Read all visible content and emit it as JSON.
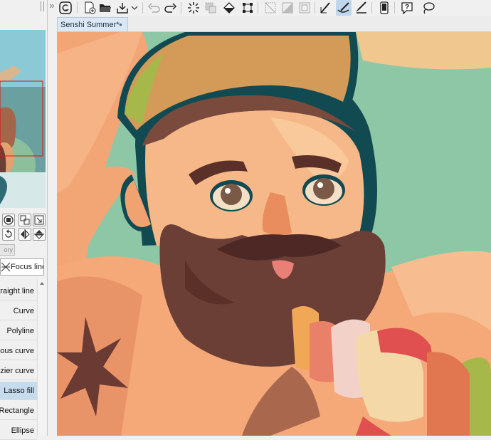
{
  "document": {
    "title": "Senshi Summer*",
    "modified_marker": "●"
  },
  "sub_panel": {
    "tab_label": "ory"
  },
  "focus_line": {
    "label": "Focus line"
  },
  "subtools": [
    {
      "label": "traight line",
      "selected": false
    },
    {
      "label": "Curve",
      "selected": false
    },
    {
      "label": "Polyline",
      "selected": false
    },
    {
      "label": "ous curve",
      "selected": false
    },
    {
      "label": "ezier curve",
      "selected": false
    },
    {
      "label": "Lasso fill",
      "selected": true
    },
    {
      "label": "Rectangle",
      "selected": false
    },
    {
      "label": "Ellipse",
      "selected": false
    }
  ],
  "toolbar": {
    "icons": [
      "app-logo-icon",
      "new-canvas-icon",
      "open-folder-icon",
      "save-icon",
      "undo-icon",
      "redo-icon",
      "clear-selection-icon",
      "fill-icon",
      "transform-icon",
      "deselect-icon",
      "invert-selection-icon",
      "selection-border-icon",
      "vector-pen-icon",
      "vector-brush-icon",
      "vector-eraser-icon",
      "smartphone-icon",
      "help-icon",
      "lasso-icon"
    ]
  },
  "colors": {
    "accent_selected": "#c5dcee",
    "canvas_bg": "#8dc7a6",
    "skin": "#f4a97c",
    "beard": "#6b3f35",
    "outline": "#124a52",
    "hat": "#d49a57"
  }
}
